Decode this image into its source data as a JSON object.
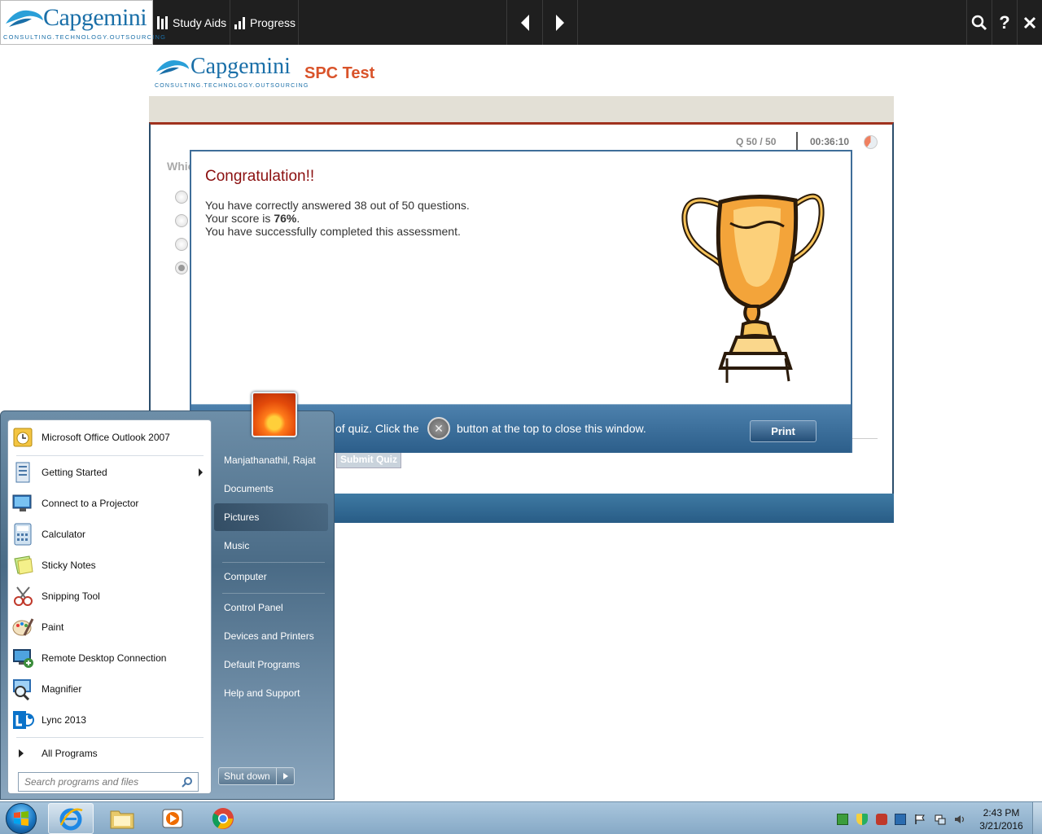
{
  "topbar": {
    "logo_text": "Capgemini",
    "logo_tagline": "CONSULTING.TECHNOLOGY.OUTSOURCING",
    "study_aids_label": "Study Aids",
    "progress_label": "Progress"
  },
  "page": {
    "logo_text": "Capgemini",
    "logo_tagline": "CONSULTING.TECHNOLOGY.OUTSOURCING",
    "title": "SPC Test",
    "question_counter": "Q 50 / 50",
    "timer": "00:36:10",
    "question_stub": "Whic",
    "submit_label": "Submit Quiz"
  },
  "dialog": {
    "title": "Congratulation!!",
    "line1": "You have correctly answered 38 out of 50 questions.",
    "line2_prefix": "Your score is ",
    "score": "76%",
    "line2_suffix": ".",
    "line3": "You have successfully completed this assessment.",
    "footer_partial": "of quiz. Click the",
    "footer_rest": "button at the top to close this window.",
    "print_label": "Print"
  },
  "start_menu": {
    "programs": [
      {
        "label": "Microsoft Office Outlook 2007",
        "icon": "outlook-icon"
      },
      {
        "label": "Getting Started",
        "icon": "getting-started-icon"
      },
      {
        "label": "Connect to a Projector",
        "icon": "projector-icon"
      },
      {
        "label": "Calculator",
        "icon": "calculator-icon"
      },
      {
        "label": "Sticky Notes",
        "icon": "sticky-notes-icon"
      },
      {
        "label": "Snipping Tool",
        "icon": "snipping-tool-icon"
      },
      {
        "label": "Paint",
        "icon": "paint-icon"
      },
      {
        "label": "Remote Desktop Connection",
        "icon": "remote-desktop-icon"
      },
      {
        "label": "Magnifier",
        "icon": "magnifier-icon"
      },
      {
        "label": "Lync 2013",
        "icon": "lync-icon"
      }
    ],
    "all_programs": "All Programs",
    "search_placeholder": "Search programs and files",
    "user_name": "Manjathanathil, Rajat",
    "places": [
      "Documents",
      "Pictures",
      "Music",
      "Computer",
      "Control Panel",
      "Devices and Printers",
      "Default Programs",
      "Help and Support"
    ],
    "shutdown_label": "Shut down"
  },
  "taskbar": {
    "time": "2:43 PM",
    "date": "3/21/2016"
  },
  "colors": {
    "title_orange": "#d9532a",
    "congrats_red": "#8b1010",
    "brand_blue": "#1a6fa8"
  }
}
